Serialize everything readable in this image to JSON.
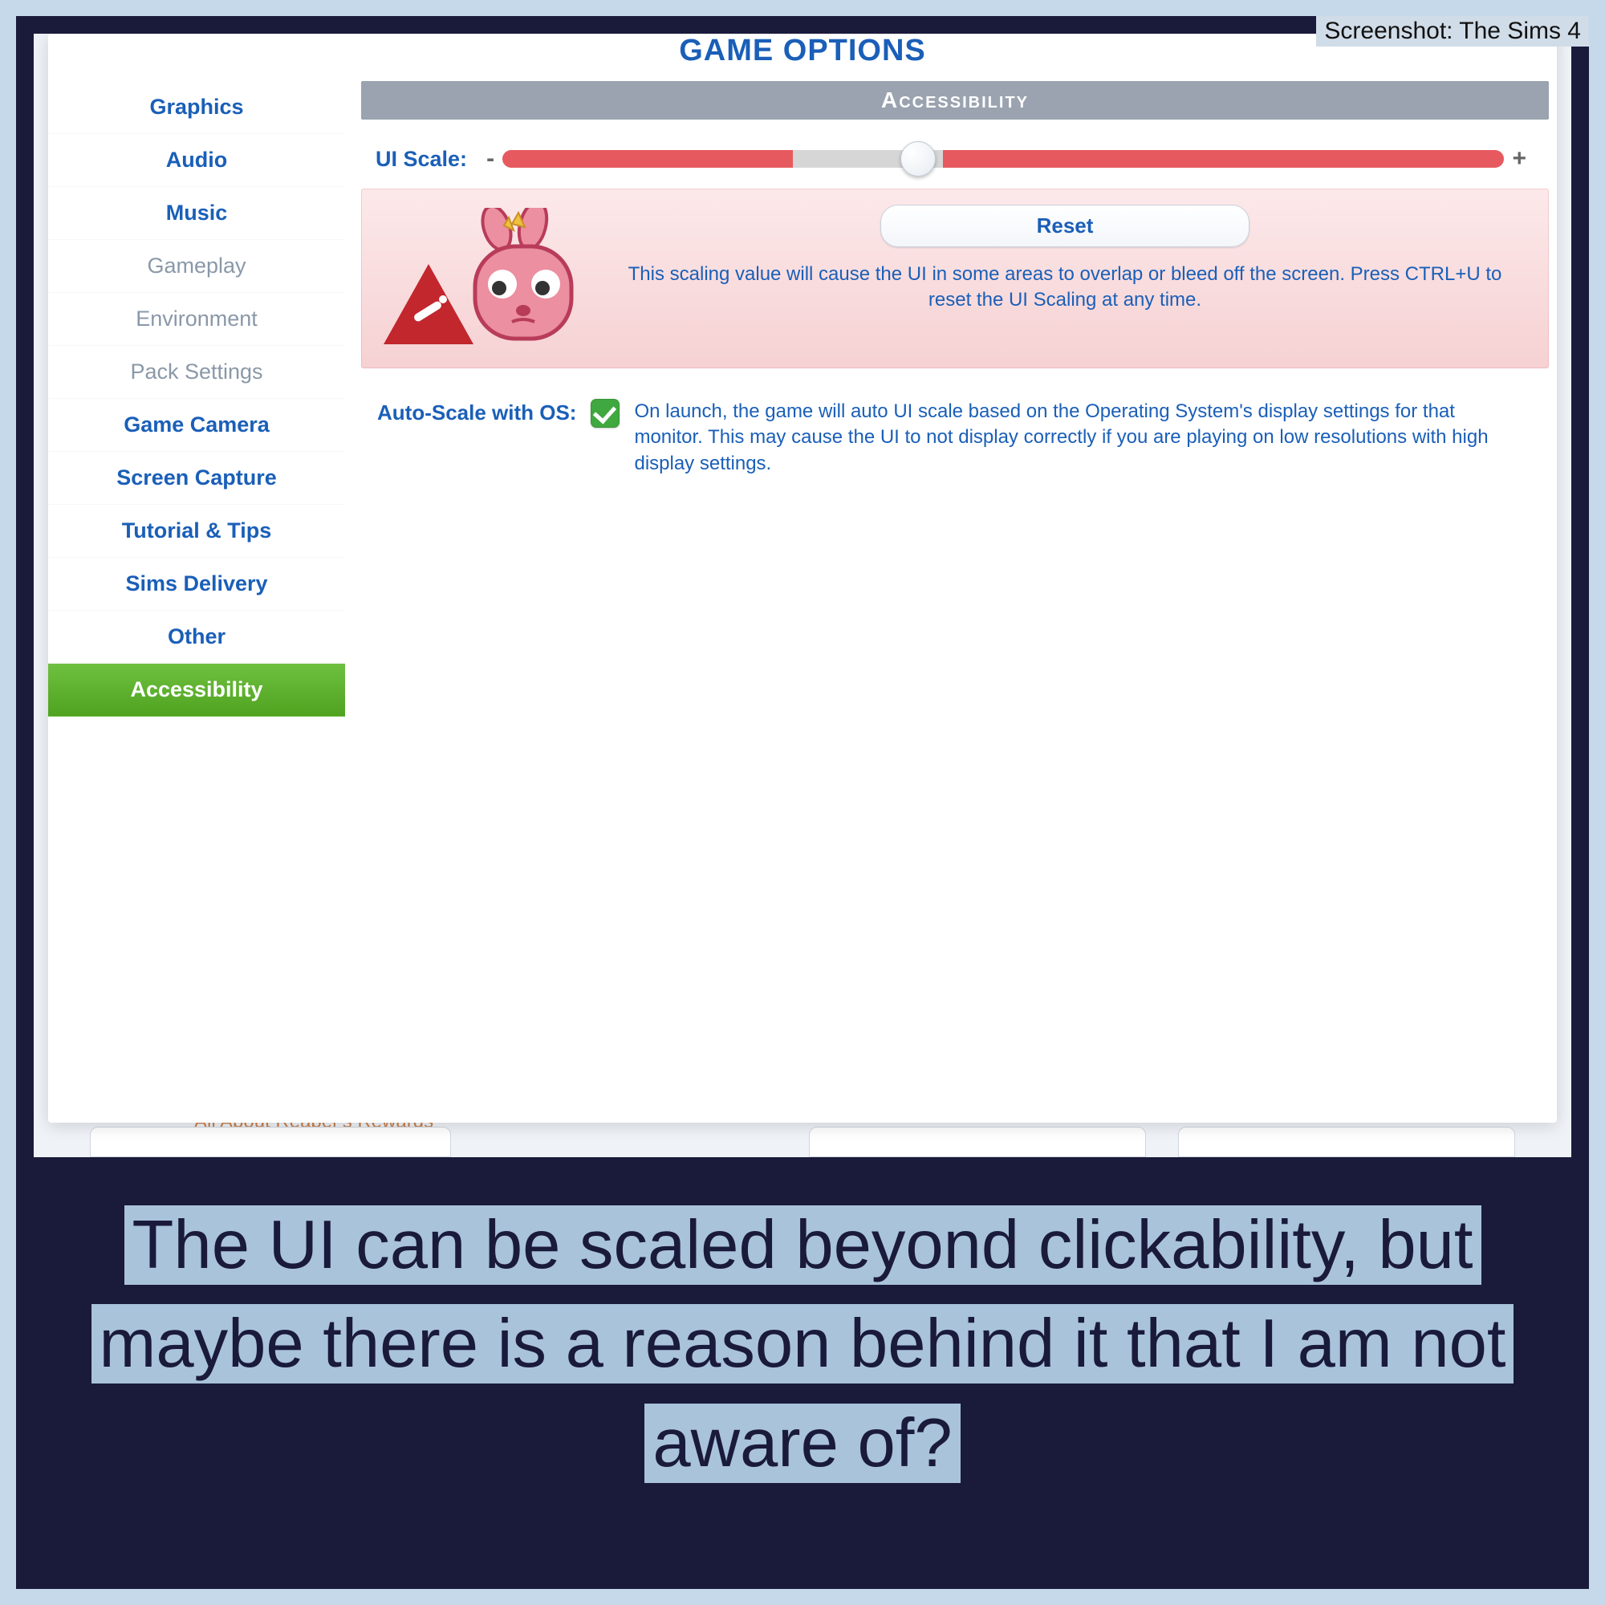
{
  "source_label": "Screenshot: The Sims 4",
  "window_title": "GAME OPTIONS",
  "sidebar": {
    "items": [
      {
        "label": "Graphics",
        "style": "normal"
      },
      {
        "label": "Audio",
        "style": "normal"
      },
      {
        "label": "Music",
        "style": "normal"
      },
      {
        "label": "Gameplay",
        "style": "muted"
      },
      {
        "label": "Environment",
        "style": "muted"
      },
      {
        "label": "Pack Settings",
        "style": "muted"
      },
      {
        "label": "Game Camera",
        "style": "normal"
      },
      {
        "label": "Screen Capture",
        "style": "normal"
      },
      {
        "label": "Tutorial & Tips",
        "style": "normal"
      },
      {
        "label": "Sims Delivery",
        "style": "normal"
      },
      {
        "label": "Other",
        "style": "normal"
      },
      {
        "label": "Accessibility",
        "style": "active"
      }
    ]
  },
  "panel": {
    "header": "Accessibility",
    "ui_scale": {
      "label": "UI Scale:",
      "minus": "-",
      "plus": "+",
      "value_percent": 41,
      "reset_label": "Reset",
      "warning_text": "This scaling value will cause the UI in some areas to overlap or bleed off the screen. Press CTRL+U to reset the UI Scaling at any time."
    },
    "auto_scale": {
      "label": "Auto-Scale with OS:",
      "checked": true,
      "description": "On launch, the game will auto UI scale based on the Operating System's display settings for that monitor. This may cause the UI to not display correctly if you are playing on low resolutions with high display settings."
    }
  },
  "background_hint": "All About Reaper's Rewards",
  "caption": "The UI can be scaled beyond clickability, but maybe there is a reason behind it that I am not aware of?"
}
